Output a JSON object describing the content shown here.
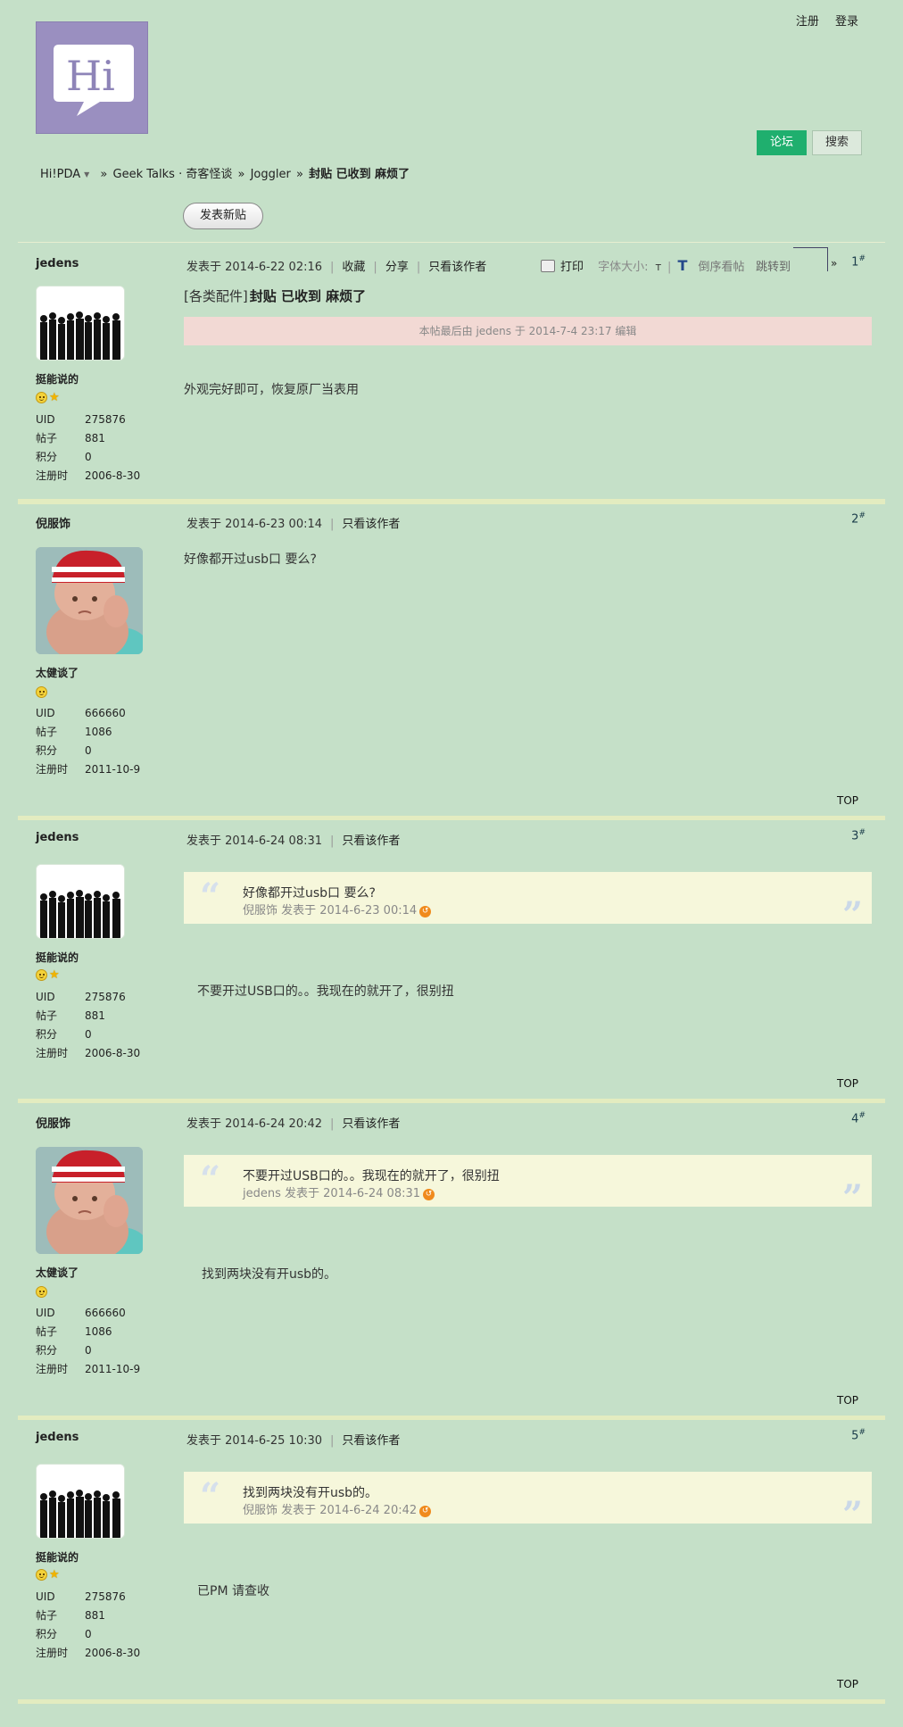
{
  "header": {
    "logo_text": "Hi",
    "links": {
      "register": "注册",
      "login": "登录"
    },
    "tabs": {
      "forum": "论坛",
      "search": "搜索"
    }
  },
  "breadcrumb": {
    "site": "Hi!PDA",
    "items": [
      "Geek Talks · 奇客怪谈",
      "Joggler"
    ],
    "current": "封贴 已收到 麻烦了"
  },
  "buttons": {
    "new_post": "发表新贴"
  },
  "thread": {
    "category": "[各类配件]",
    "title": "封贴 已收到 麻烦了",
    "edit_note": "本帖最后由 jedens 于 2014-7-4 23:17 编辑"
  },
  "labels": {
    "uid": "UID",
    "posts": "帖子",
    "points": "积分",
    "registered": "注册时",
    "author_only": "只看该作者",
    "favorite": "收藏",
    "share": "分享",
    "print": "打印",
    "font_size": "字体大小:",
    "font_small": "T",
    "font_large": "T",
    "reverse": "倒序看帖",
    "jump": "跳转到",
    "jump_arrow": "»",
    "top": "TOP"
  },
  "posts": [
    {
      "floor": "1",
      "author": "jedens",
      "time": "发表于 2014-6-22 02:16",
      "rank": "挺能说的",
      "uid": "275876",
      "posts": "881",
      "points": "0",
      "reg": "2006-8-30",
      "body": "外观完好即可，恢复原厂当表用"
    },
    {
      "floor": "2",
      "author": "倪服饰",
      "time": "发表于 2014-6-23 00:14",
      "rank": "太健谈了",
      "uid": "666660",
      "posts": "1086",
      "points": "0",
      "reg": "2011-10-9",
      "body": "好像都开过usb口 要么?"
    },
    {
      "floor": "3",
      "author": "jedens",
      "time": "发表于 2014-6-24 08:31",
      "rank": "挺能说的",
      "uid": "275876",
      "posts": "881",
      "points": "0",
      "reg": "2006-8-30",
      "quote_text": "好像都开过usb口 要么?",
      "quote_info": "倪服饰 发表于 2014-6-23 00:14",
      "body": "不要开过USB口的。。我现在的就开了，很别扭"
    },
    {
      "floor": "4",
      "author": "倪服饰",
      "time": "发表于 2014-6-24 20:42",
      "rank": "太健谈了",
      "uid": "666660",
      "posts": "1086",
      "points": "0",
      "reg": "2011-10-9",
      "quote_text": "不要开过USB口的。。我现在的就开了，很别扭",
      "quote_info": "jedens 发表于 2014-6-24 08:31",
      "body": "找到两块没有开usb的。"
    },
    {
      "floor": "5",
      "author": "jedens",
      "time": "发表于 2014-6-25 10:30",
      "rank": "挺能说的",
      "uid": "275876",
      "posts": "881",
      "points": "0",
      "reg": "2006-8-30",
      "quote_text": "找到两块没有开usb的。",
      "quote_info": "倪服饰 发表于 2014-6-24 20:42",
      "body": "已PM 请查收"
    }
  ],
  "colors": {
    "background": "#c5e0c8",
    "accent": "#1faf6e",
    "edit_bar": "#f2d9d4",
    "quote_bg": "#f6f7db"
  }
}
